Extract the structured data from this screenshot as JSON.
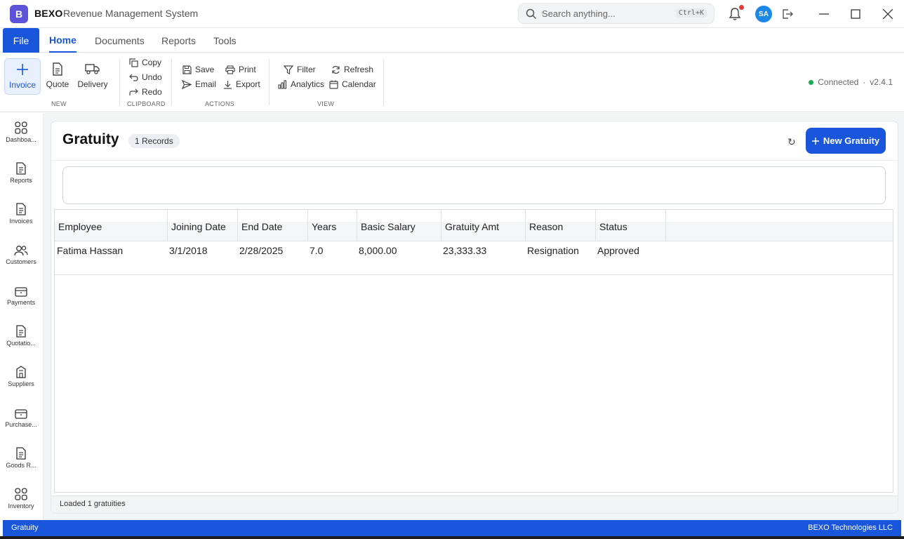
{
  "app": {
    "logo": "B",
    "name": "BEXO",
    "subtitle": "Revenue Management System"
  },
  "search": {
    "placeholder": "Search anything...",
    "shortcut": "Ctrl+K"
  },
  "user": {
    "initials": "SA"
  },
  "icons": {
    "notification": "bell-icon",
    "logout": "logout-icon",
    "minimize": "minimize-icon",
    "maximize": "maximize-icon",
    "close": "close-icon"
  },
  "tabs": {
    "file": "File",
    "items": [
      "Home",
      "Documents",
      "Reports",
      "Tools"
    ],
    "active": "Home"
  },
  "ribbon": {
    "new": {
      "label": "NEW",
      "invoice": "Invoice",
      "quote": "Quote",
      "delivery": "Delivery"
    },
    "clipboard": {
      "label": "CLIPBOARD",
      "copy": "Copy",
      "undo": "Undo",
      "redo": "Redo"
    },
    "actions": {
      "label": "ACTIONS",
      "save": "Save",
      "print": "Print",
      "email": "Email",
      "export": "Export"
    },
    "view": {
      "label": "VIEW",
      "filter": "Filter",
      "refresh": "Refresh",
      "analytics": "Analytics",
      "calendar": "Calendar"
    },
    "status": {
      "connection": "Connected",
      "separator": "·",
      "version": "v2.4.1",
      "connection_color": "#1aaa55"
    }
  },
  "sidebar": {
    "items": [
      "Dashboa...",
      "Reports",
      "Invoices",
      "Customers",
      "Payments",
      "Quotatio...",
      "Suppliers",
      "Purchase...",
      "Goods R...",
      "Inventory"
    ]
  },
  "page": {
    "title": "Gratuity",
    "record_badge": "1 Records",
    "refresh_glyph": "↻",
    "new_button": "New Gratuity",
    "status": "Loaded 1 gratuities"
  },
  "table": {
    "columns": [
      "Employee",
      "Joining Date",
      "End Date",
      "Years",
      "Basic Salary",
      "Gratuity Amt",
      "Reason",
      "Status"
    ],
    "rows": [
      [
        "Fatima Hassan",
        "3/1/2018",
        "2/28/2025",
        "7.0",
        "8,000.00",
        "23,333.33",
        "Resignation",
        "Approved"
      ]
    ]
  },
  "footer": {
    "left": "Gratuity",
    "right": "BEXO Technologies LLC"
  },
  "colors": {
    "accent": "#1a56db",
    "logo": "#5b54d9",
    "notification_dot": "#e53935"
  }
}
